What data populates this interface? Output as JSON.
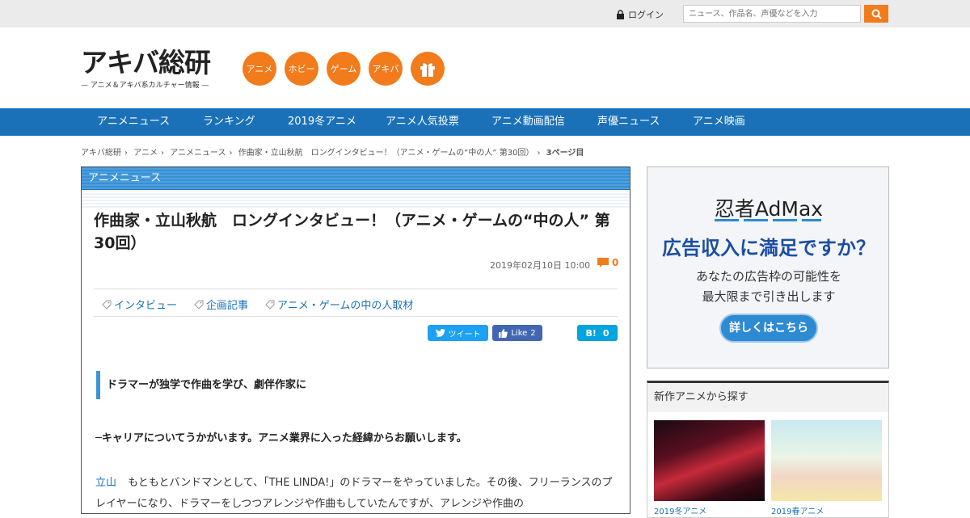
{
  "header": {
    "login_label": "ログイン",
    "search_placeholder": "ニュース、作品名、声優などを入力",
    "logo_title": "アキバ総研",
    "logo_tagline": "— アニメ＆アキバ系カルチャー情報 —",
    "categories": [
      "アニメ",
      "ホビー",
      "ゲーム",
      "アキバ"
    ],
    "accent_color": "#f27b1b"
  },
  "global_nav": {
    "items": [
      "アニメニュース",
      "ランキング",
      "2019冬アニメ",
      "アニメ人気投票",
      "アニメ動画配信",
      "声優ニュース",
      "アニメ映画"
    ],
    "color": "#1b71b8"
  },
  "breadcrumb": [
    "アキバ総研",
    "アニメ",
    "アニメニュース",
    "作曲家・立山秋航　ロングインタビュー！（アニメ・ゲームの“中の人” 第30回）",
    "3ページ目"
  ],
  "article": {
    "section_label": "アニメニュース",
    "title": "作曲家・立山秋航　ロングインタビュー！（アニメ・ゲームの“中の人” 第30回）",
    "date": "2019年02月10日 10:00",
    "comment_count": "0",
    "tags": [
      "インタビュー",
      "企画記事",
      "アニメ・ゲームの中の人取材"
    ],
    "share": {
      "tweet_label": "ツイート",
      "like_label": "Like",
      "like_count": "2",
      "hatena_label": "B!",
      "hatena_count": "0"
    },
    "subheading": "ドラマーが独学で作曲を学び、劇伴作家に",
    "question": "─キャリアについてうかがいます。アニメ業界に入った経緯からお願いします。",
    "speaker": "立山",
    "answer": "もともとバンドマンとして、「THE LINDA!」のドラマーをやっていました。その後、フリーランスのプレイヤーになり、ドラマーをしつつアレンジや作曲もしていたんですが、アレンジや作曲の"
  },
  "sidebar": {
    "ad": {
      "brand": "忍者AdMax",
      "headline": "広告収入に満足ですか？",
      "line1": "あなたの広告枠の可能性を",
      "line2": "最大限まで引き出します",
      "button_label": "詳しくはこちら"
    },
    "new_anime": {
      "title": "新作アニメから探す",
      "captions": [
        "2019冬アニメ",
        "2019春アニメ"
      ]
    }
  }
}
